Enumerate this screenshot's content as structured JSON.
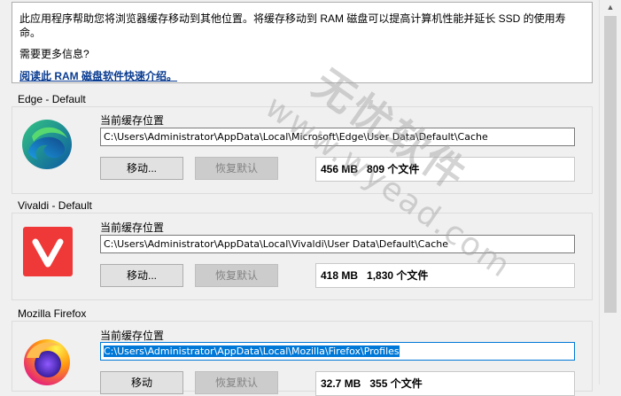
{
  "info": {
    "text": "此应用程序帮助您将浏览器缓存移动到其他位置。将缓存移动到 RAM 磁盘可以提高计算机性能并延长 SSD 的使用寿命。",
    "more": "需要更多信息?",
    "link": "阅读此 RAM 磁盘软件快速介绍。"
  },
  "browsers": [
    {
      "title": "Edge - Default",
      "icon": "edge-icon",
      "location_label": "当前缓存位置",
      "path": "C:\\Users\\Administrator\\AppData\\Local\\Microsoft\\Edge\\User Data\\Default\\Cache",
      "move_label": "移动...",
      "restore_label": "恢复默认",
      "size": "456 MB",
      "files": "809 个文件"
    },
    {
      "title": "Vivaldi - Default",
      "icon": "vivaldi-icon",
      "location_label": "当前缓存位置",
      "path": "C:\\Users\\Administrator\\AppData\\Local\\Vivaldi\\User Data\\Default\\Cache",
      "move_label": "移动...",
      "restore_label": "恢复默认",
      "size": "418 MB",
      "files": "1,830 个文件"
    },
    {
      "title": "Mozilla Firefox",
      "icon": "firefox-icon",
      "location_label": "当前缓存位置",
      "path": "C:\\Users\\Administrator\\AppData\\Local\\Mozilla\\Firefox\\Profiles",
      "move_label": "移动",
      "restore_label": "恢复默认",
      "size": "32.7 MB",
      "files": "355 个文件"
    }
  ],
  "watermark": {
    "cn": "无忧软件",
    "url": "www.wyead.com"
  },
  "colors": {
    "link": "#0b3d91",
    "selection": "#0078d7",
    "vivaldi": "#ef3939"
  }
}
